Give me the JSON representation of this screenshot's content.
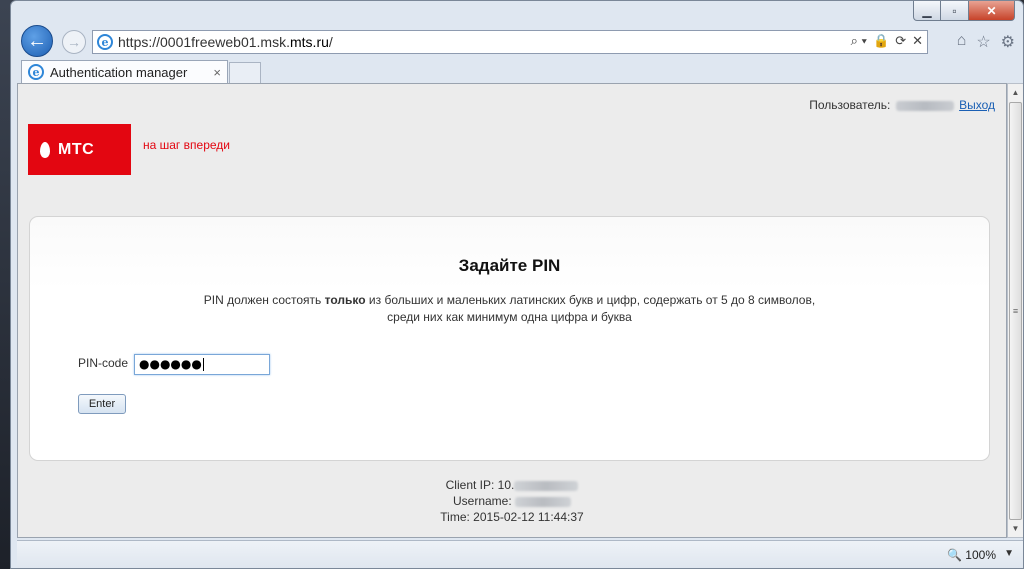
{
  "window": {
    "minimize": "▁",
    "maximize": "▫",
    "close": "✕"
  },
  "nav": {
    "back_icon": "←",
    "forward_icon": "→",
    "url_prefix": "https://0001freeweb01.msk.",
    "url_domain": "mts.ru",
    "url_suffix": "/",
    "address_tools": [
      "⌕ ▾",
      "🔒",
      "⟳",
      "✕"
    ]
  },
  "browser_icons": {
    "home": "⌂",
    "favorites": "☆",
    "settings": "⚙"
  },
  "tab": {
    "title": "Authentication manager",
    "close": "×"
  },
  "page": {
    "user_label": "Пользователь:",
    "logout": "Выход",
    "logo_text": "МТС",
    "slogan": "на шаг впереди",
    "title": "Задайте PIN",
    "desc_part1": "PIN должен состоять ",
    "desc_bold": "только",
    "desc_part2": " из больших и маленьких латинских букв и цифр, содержать от 5 до 8 символов,",
    "desc_line2": "среди них как минимум одна цифра и буква",
    "pin_label": "PIN-code",
    "pin_value": "●●●●●●",
    "enter_button": "Enter",
    "client_ip_label": "Client IP: 10.",
    "username_label": "Username:",
    "time_line": "Time: 2015-02-12 11:44:37"
  },
  "scrollbar": {
    "up": "▲",
    "down": "▼",
    "grip": "≡"
  },
  "status": {
    "zoom": "100%",
    "zoom_dropdown": "▼"
  },
  "colors": {
    "brand_red": "#e30611",
    "link_blue": "#1a5fb4"
  }
}
